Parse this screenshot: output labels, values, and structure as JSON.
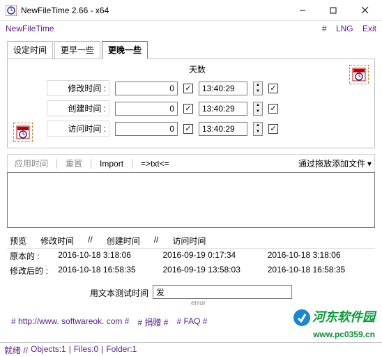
{
  "window": {
    "title": "NewFileTime 2.66 - x64"
  },
  "menu": {
    "appname": "NewFileTime",
    "hash": "#",
    "lng": "LNG",
    "exit": "Exit"
  },
  "tabs": {
    "set": "设定时间",
    "earlier": "更早一些",
    "later": "更晚一些"
  },
  "panel": {
    "days_header": "天数",
    "rows": [
      {
        "label": "修改时间 :",
        "num": "0",
        "time": "13:40:29"
      },
      {
        "label": "创建时间 :",
        "num": "0",
        "time": "13:40:29"
      },
      {
        "label": "访问时间 :",
        "num": "0",
        "time": "13:40:29"
      }
    ]
  },
  "toolbar": {
    "apply": "应用时间",
    "reset": "重置",
    "import": "Import",
    "txt": "=>txt<=",
    "dragdrop": "通过拖放添加文件"
  },
  "preview": {
    "title": "预览",
    "col_mod": "修改时间",
    "col_create": "创建时间",
    "col_access": "访问时间",
    "slash": "//",
    "orig_label": "原本的 :",
    "after_label": "修改后的 :",
    "orig": {
      "mod": "2016-10-18 3:18:06",
      "create": "2016-09-19 0:17:34",
      "access": "2016-10-18 3:18:06"
    },
    "after": {
      "mod": "2016-10-18 16:58:35",
      "create": "2016-09-19 13:58:03",
      "access": "2016-10-18 16:58:35"
    }
  },
  "texttest": {
    "label": "用文本测试时间",
    "value": "发",
    "error": "error"
  },
  "links": {
    "site": "# http://www. softwareok. com #",
    "donate": "# 捐赠 #",
    "faq": "# FAQ #"
  },
  "status": {
    "ready": "就绪 //",
    "objects": "Objects:1",
    "files": "Files:0",
    "folder": "Folder:1"
  },
  "watermark": {
    "name": "河东软件园",
    "url": "www.pc0359.cn"
  }
}
